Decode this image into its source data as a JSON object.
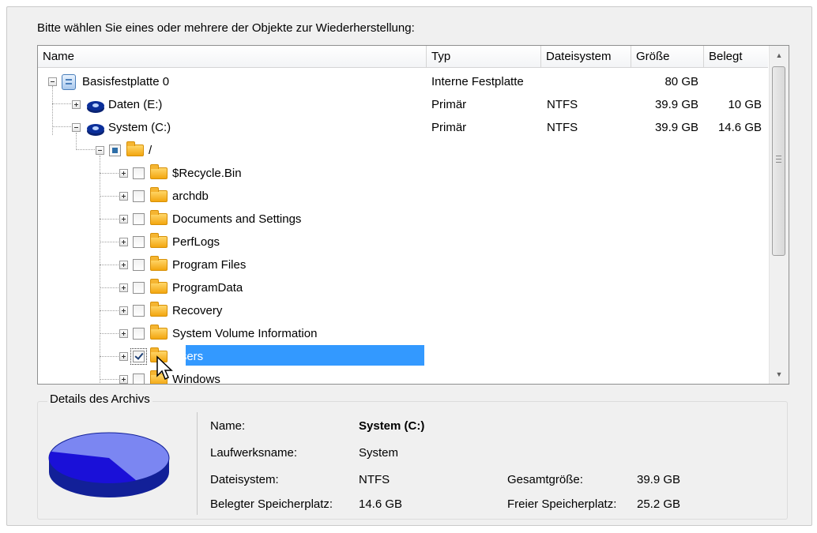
{
  "prompt": "Bitte wählen Sie eines oder mehrere der Objekte zur Wiederherstellung:",
  "columns": [
    "Name",
    "Typ",
    "Dateisystem",
    "Größe",
    "Belegt"
  ],
  "rows": [
    {
      "name": "Basisfestplatte 0",
      "typ": "Interne Festplatte",
      "fs": "",
      "size": "80 GB",
      "used": ""
    },
    {
      "name": "Daten (E:)",
      "typ": "Primär",
      "fs": "NTFS",
      "size": "39.9 GB",
      "used": "10 GB"
    },
    {
      "name": "System (C:)",
      "typ": "Primär",
      "fs": "NTFS",
      "size": "39.9 GB",
      "used": "14.6 GB"
    },
    {
      "name": "/",
      "typ": "",
      "fs": "",
      "size": "",
      "used": ""
    },
    {
      "name": "$Recycle.Bin"
    },
    {
      "name": "archdb"
    },
    {
      "name": "Documents and Settings"
    },
    {
      "name": "PerfLogs"
    },
    {
      "name": "Program Files"
    },
    {
      "name": "ProgramData"
    },
    {
      "name": "Recovery"
    },
    {
      "name": "System Volume Information"
    },
    {
      "name": "Users",
      "checked": true,
      "selected": true
    },
    {
      "name": "Windows"
    }
  ],
  "details": {
    "legend": "Details des Archivs",
    "name_label": "Name:",
    "name_value": "System (C:)",
    "drive_label": "Laufwerksname:",
    "drive_value": "System",
    "fs_label": "Dateisystem:",
    "fs_value": "NTFS",
    "total_label": "Gesamtgröße:",
    "total_value": "39.9 GB",
    "used_label": "Belegter Speicherplatz:",
    "used_value": "14.6 GB",
    "free_label": "Freier Speicherplatz:",
    "free_value": "25.2 GB"
  },
  "pie": {
    "used_fraction": 0.366,
    "used_color": "#1a10d8",
    "free_color": "#7b86f2",
    "edge_color": "#122098"
  },
  "icons": {
    "disk": "hard-disk-icon",
    "volume": "volume-icon",
    "folder": "folder-icon",
    "expander": "tree-expander-icon",
    "cursor": "mouse-cursor-icon"
  }
}
